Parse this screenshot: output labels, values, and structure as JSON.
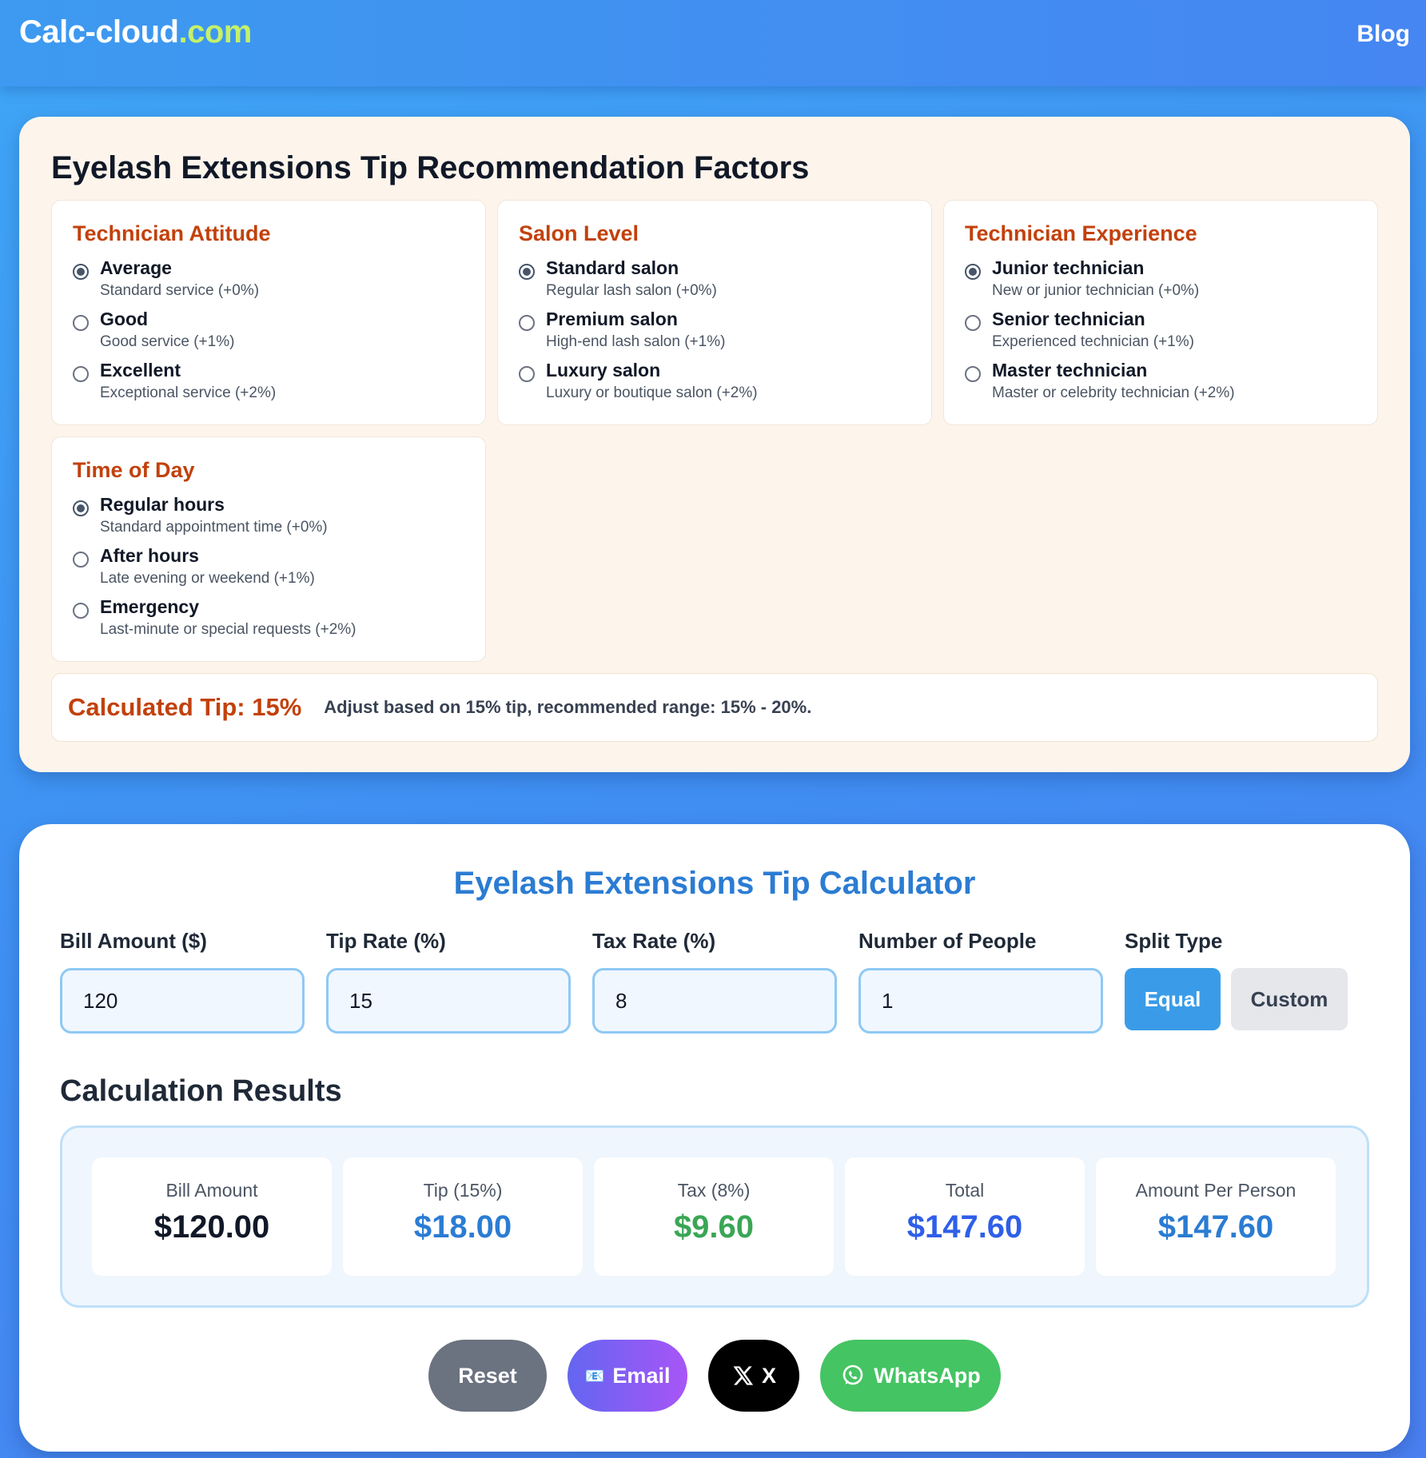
{
  "header": {
    "logo_main": "Calc-cloud",
    "logo_tld": ".com",
    "nav_blog": "Blog"
  },
  "factors": {
    "title": "Eyelash Extensions Tip Recommendation Factors",
    "groups": [
      {
        "title": "Technician Attitude",
        "options": [
          {
            "label": "Average",
            "desc": "Standard service (+0%)",
            "checked": true
          },
          {
            "label": "Good",
            "desc": "Good service (+1%)",
            "checked": false
          },
          {
            "label": "Excellent",
            "desc": "Exceptional service (+2%)",
            "checked": false
          }
        ]
      },
      {
        "title": "Salon Level",
        "options": [
          {
            "label": "Standard salon",
            "desc": "Regular lash salon (+0%)",
            "checked": true
          },
          {
            "label": "Premium salon",
            "desc": "High-end lash salon (+1%)",
            "checked": false
          },
          {
            "label": "Luxury salon",
            "desc": "Luxury or boutique salon (+2%)",
            "checked": false
          }
        ]
      },
      {
        "title": "Technician Experience",
        "options": [
          {
            "label": "Junior technician",
            "desc": "New or junior technician (+0%)",
            "checked": true
          },
          {
            "label": "Senior technician",
            "desc": "Experienced technician (+1%)",
            "checked": false
          },
          {
            "label": "Master technician",
            "desc": "Master or celebrity technician (+2%)",
            "checked": false
          }
        ]
      },
      {
        "title": "Time of Day",
        "options": [
          {
            "label": "Regular hours",
            "desc": "Standard appointment time (+0%)",
            "checked": true
          },
          {
            "label": "After hours",
            "desc": "Late evening or weekend (+1%)",
            "checked": false
          },
          {
            "label": "Emergency",
            "desc": "Last-minute or special requests (+2%)",
            "checked": false
          }
        ]
      }
    ],
    "calculated_tip_label": "Calculated Tip: 15%",
    "calculated_tip_text": "Adjust based on 15% tip, recommended range: 15% - 20%."
  },
  "calculator": {
    "title": "Eyelash Extensions Tip Calculator",
    "fields": {
      "bill": {
        "label": "Bill Amount ($)",
        "value": "120"
      },
      "tip": {
        "label": "Tip Rate (%)",
        "value": "15"
      },
      "tax": {
        "label": "Tax Rate (%)",
        "value": "8"
      },
      "people": {
        "label": "Number of People",
        "value": "1"
      }
    },
    "split": {
      "label": "Split Type",
      "equal": "Equal",
      "custom": "Custom",
      "selected": "Equal"
    },
    "results_title": "Calculation Results",
    "results": [
      {
        "label": "Bill Amount",
        "value": "$120.00",
        "color": "#111827"
      },
      {
        "label": "Tip (15%)",
        "value": "$18.00",
        "color": "#2b7cd3"
      },
      {
        "label": "Tax (8%)",
        "value": "$9.60",
        "color": "#3aa655"
      },
      {
        "label": "Total",
        "value": "$147.60",
        "color": "#2f5fe8"
      },
      {
        "label": "Amount Per Person",
        "value": "$147.60",
        "color": "#2b7cd3"
      }
    ],
    "actions": {
      "reset": "Reset",
      "email": "Email",
      "email_icon": "📧",
      "x": "X",
      "whatsapp": "WhatsApp"
    }
  },
  "colors": {
    "accent_orange": "#c2410c",
    "primary_blue": "#3a9ce8",
    "logo_tld": "#c4f06a"
  }
}
